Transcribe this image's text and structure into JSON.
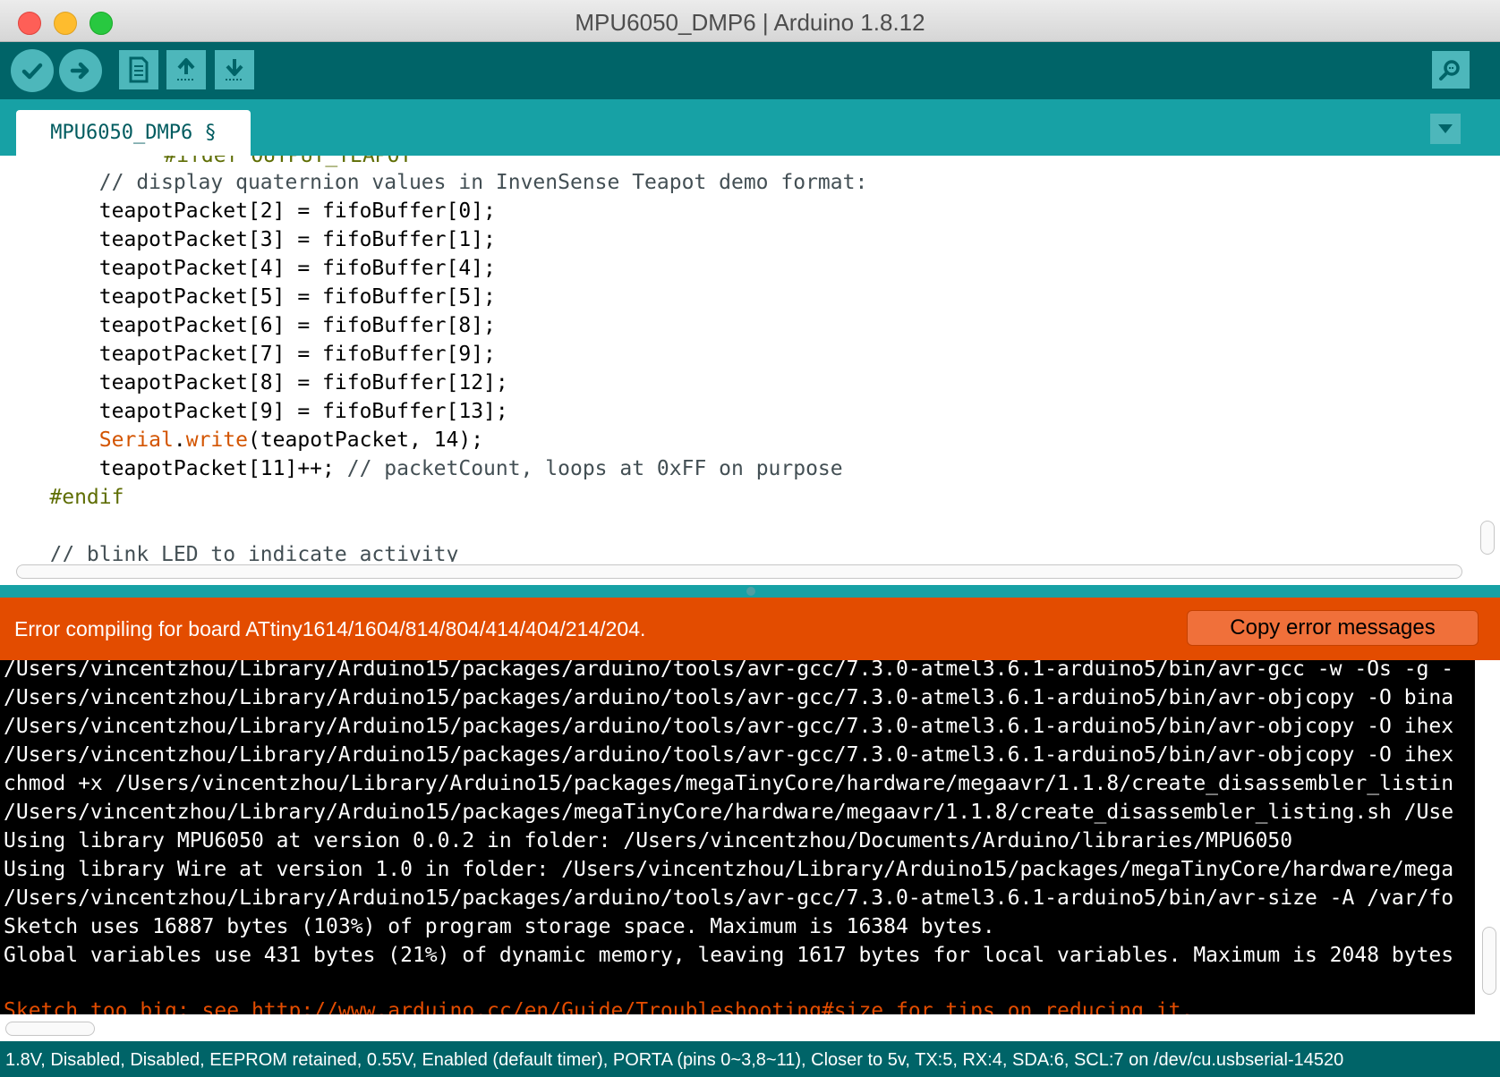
{
  "window": {
    "title": "MPU6050_DMP6 | Arduino 1.8.12"
  },
  "toolbar": {
    "verify": "verify-icon",
    "upload": "upload-arrow-icon",
    "new": "new-sketch-icon",
    "open": "open-icon",
    "save": "save-icon",
    "serial_monitor": "serial-monitor-icon"
  },
  "tab": {
    "label": "MPU6050_DMP6 §"
  },
  "editor": {
    "lines": [
      "    #ifdef OUTPUT_TEAPOT",
      "        // display quaternion values in InvenSense Teapot demo format:",
      "        teapotPacket[2] = fifoBuffer[0];",
      "        teapotPacket[3] = fifoBuffer[1];",
      "        teapotPacket[4] = fifoBuffer[4];",
      "        teapotPacket[5] = fifoBuffer[5];",
      "        teapotPacket[6] = fifoBuffer[8];",
      "        teapotPacket[7] = fifoBuffer[9];",
      "        teapotPacket[8] = fifoBuffer[12];",
      "        teapotPacket[9] = fifoBuffer[13];",
      "        ",
      "        teapotPacket[11]++; ",
      "    #endif",
      "",
      "    // blink LED to indicate activity"
    ],
    "serial_kw": "Serial",
    "write_kw": "write",
    "serial_rest": "(teapotPacket, 14);",
    "comment_tail": "// packetCount, loops at 0xFF on purpose"
  },
  "status": {
    "message": "Error compiling for board ATtiny1614/1604/814/804/414/404/214/204.",
    "copy_button": "Copy error messages"
  },
  "console": {
    "lines": [
      "/Users/vincentzhou/Library/Arduino15/packages/arduino/tools/avr-gcc/7.3.0-atmel3.6.1-arduino5/bin/avr-gcc -w -Os -g -",
      "/Users/vincentzhou/Library/Arduino15/packages/arduino/tools/avr-gcc/7.3.0-atmel3.6.1-arduino5/bin/avr-objcopy -O bina",
      "/Users/vincentzhou/Library/Arduino15/packages/arduino/tools/avr-gcc/7.3.0-atmel3.6.1-arduino5/bin/avr-objcopy -O ihex",
      "/Users/vincentzhou/Library/Arduino15/packages/arduino/tools/avr-gcc/7.3.0-atmel3.6.1-arduino5/bin/avr-objcopy -O ihex",
      "chmod +x /Users/vincentzhou/Library/Arduino15/packages/megaTinyCore/hardware/megaavr/1.1.8/create_disassembler_listin",
      "/Users/vincentzhou/Library/Arduino15/packages/megaTinyCore/hardware/megaavr/1.1.8/create_disassembler_listing.sh /Use",
      "Using library MPU6050 at version 0.0.2 in folder: /Users/vincentzhou/Documents/Arduino/libraries/MPU6050",
      "Using library Wire at version 1.0 in folder: /Users/vincentzhou/Library/Arduino15/packages/megaTinyCore/hardware/mega",
      "/Users/vincentzhou/Library/Arduino15/packages/arduino/tools/avr-gcc/7.3.0-atmel3.6.1-arduino5/bin/avr-size -A /var/fo",
      "Sketch uses 16887 bytes (103%) of program storage space. Maximum is 16384 bytes.",
      "Global variables use 431 bytes (21%) of dynamic memory, leaving 1617 bytes for local variables. Maximum is 2048 bytes",
      "",
      "Sketch too big; see http://www.arduino.cc/en/Guide/Troubleshooting#size for tips on reducing it."
    ]
  },
  "footer": {
    "text": "1.8V, Disabled, Disabled, EEPROM retained, 0.55V, Enabled (default timer), PORTA (pins 0~3,8~11), Closer to 5v, TX:5, RX:4, SDA:6, SCL:7 on /dev/cu.usbserial-14520"
  },
  "colors": {
    "toolbar": "#006468",
    "tabbar": "#17a1a5",
    "button": "#4db7bb",
    "error": "#e34c00",
    "keyword": "#d35400"
  }
}
